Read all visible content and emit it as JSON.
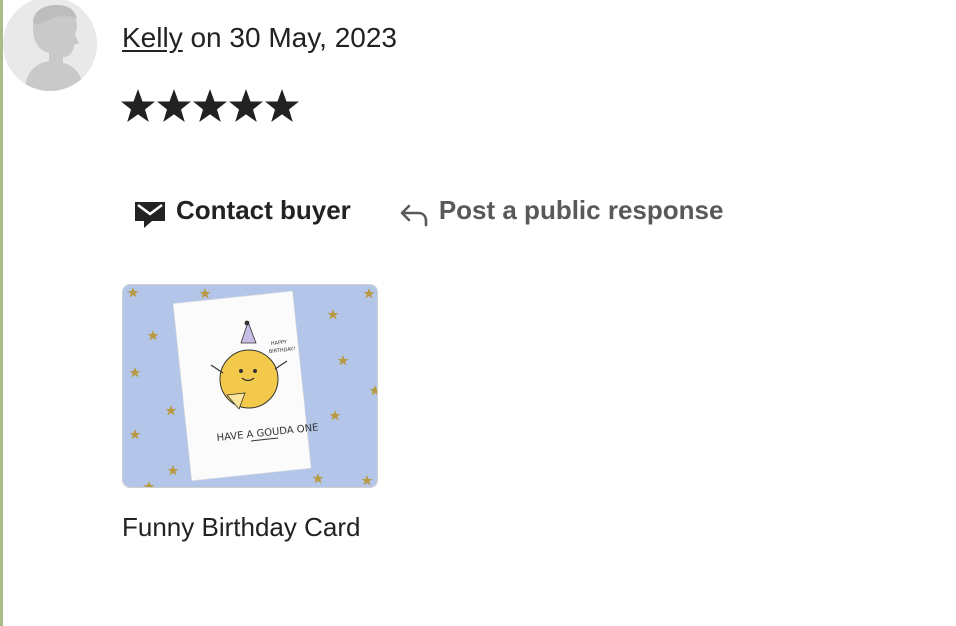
{
  "review": {
    "reviewer_name": "Kelly",
    "date_text": " on 30 May, 2023",
    "rating": 5,
    "rating_max": 5
  },
  "actions": {
    "contact_label": "Contact buyer",
    "public_label": "Post a public response"
  },
  "product": {
    "title": "Funny Birthday Card",
    "card_text_main": "HAVE A GOUDA ONE",
    "card_text_bubble": "HAPPY BIRTHDAY!"
  },
  "colors": {
    "left_rule": "#a9bb86",
    "text_primary": "#222222",
    "text_secondary": "#595959",
    "thumb_bg": "#b3c6e9",
    "star_gold": "#b89a42"
  }
}
